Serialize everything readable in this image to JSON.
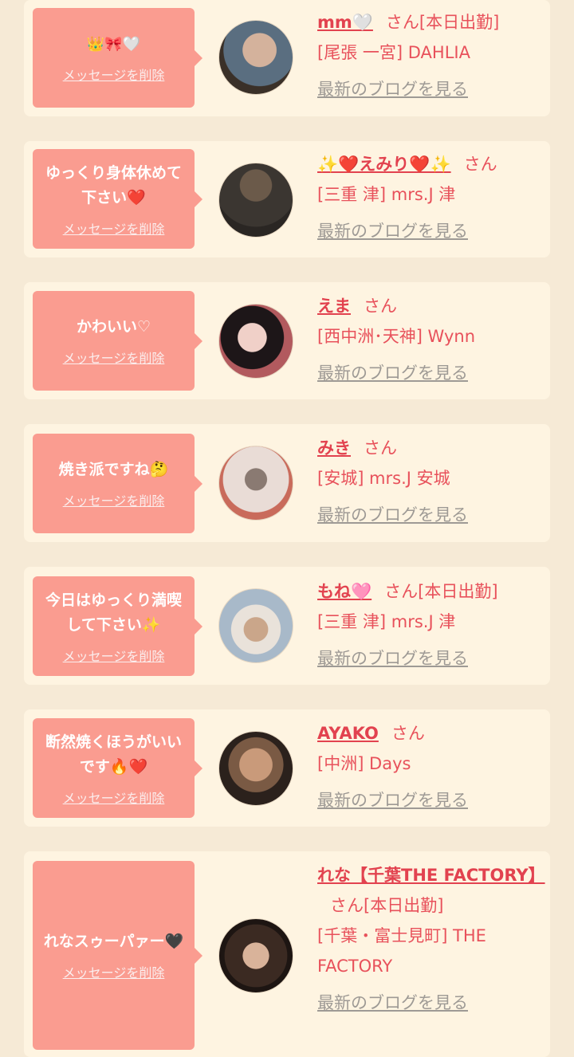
{
  "cards": [
    {
      "message": "👑🎀🤍",
      "delete_label": "メッセージを削除",
      "name": "mm🤍",
      "suffix": "さん[本日出勤]",
      "shop": "[尾張 一宮] DAHLIA",
      "blog_label": "最新のブログを見る",
      "avatar_colors": [
        "#5a6e80",
        "#d4b29c",
        "#3a3028"
      ]
    },
    {
      "message": "ゆっくり身体休めて下さい❤️",
      "delete_label": "メッセージを削除",
      "name": "✨❤️えみり❤️✨",
      "suffix": "さん",
      "shop": "[三重 津] mrs.J 津",
      "blog_label": "最新のブログを見る",
      "avatar_colors": [
        "#3b3631",
        "#6b5a4a",
        "#2a2623"
      ]
    },
    {
      "message": "かわいい♡",
      "delete_label": "メッセージを削除",
      "name": "えま",
      "suffix": "さん",
      "shop": "[西中洲･天神] Wynn",
      "blog_label": "最新のブログを見る",
      "avatar_colors": [
        "#b25a5e",
        "#f0d0c8",
        "#1d1618"
      ]
    },
    {
      "message": "焼き派ですね🤔",
      "delete_label": "メッセージを削除",
      "name": "みき",
      "suffix": "さん",
      "shop": "[安城] mrs.J 安城",
      "blog_label": "最新のブログを見る",
      "avatar_colors": [
        "#e9dcd6",
        "#c96b5b",
        "#8a7a72"
      ]
    },
    {
      "message": "今日はゆっくり満喫して下さい✨",
      "delete_label": "メッセージを削除",
      "name": "もね🩷",
      "suffix": "さん[本日出勤]",
      "shop": "[三重 津] mrs.J 津",
      "blog_label": "最新のブログを見る",
      "avatar_colors": [
        "#a8b9c9",
        "#e9e2da",
        "#caa68a"
      ]
    },
    {
      "message": "断然焼くほうがいいです🔥❤️",
      "delete_label": "メッセージを削除",
      "name": "AYAKO",
      "suffix": "さん",
      "shop": "[中洲] Days",
      "blog_label": "最新のブログを見る",
      "avatar_colors": [
        "#c99a7a",
        "#2b211c",
        "#7a5a44"
      ]
    },
    {
      "message": "れなスゥーパァー🖤",
      "delete_label": "メッセージを削除",
      "name": "れな【千葉THE FACTORY】",
      "suffix": "さん[本日出勤]",
      "shop": "[千葉・富士見町] THE FACTORY",
      "blog_label": "最新のブログを見る",
      "avatar_colors": [
        "#3b2a22",
        "#d9b39a",
        "#1d1512"
      ]
    }
  ]
}
